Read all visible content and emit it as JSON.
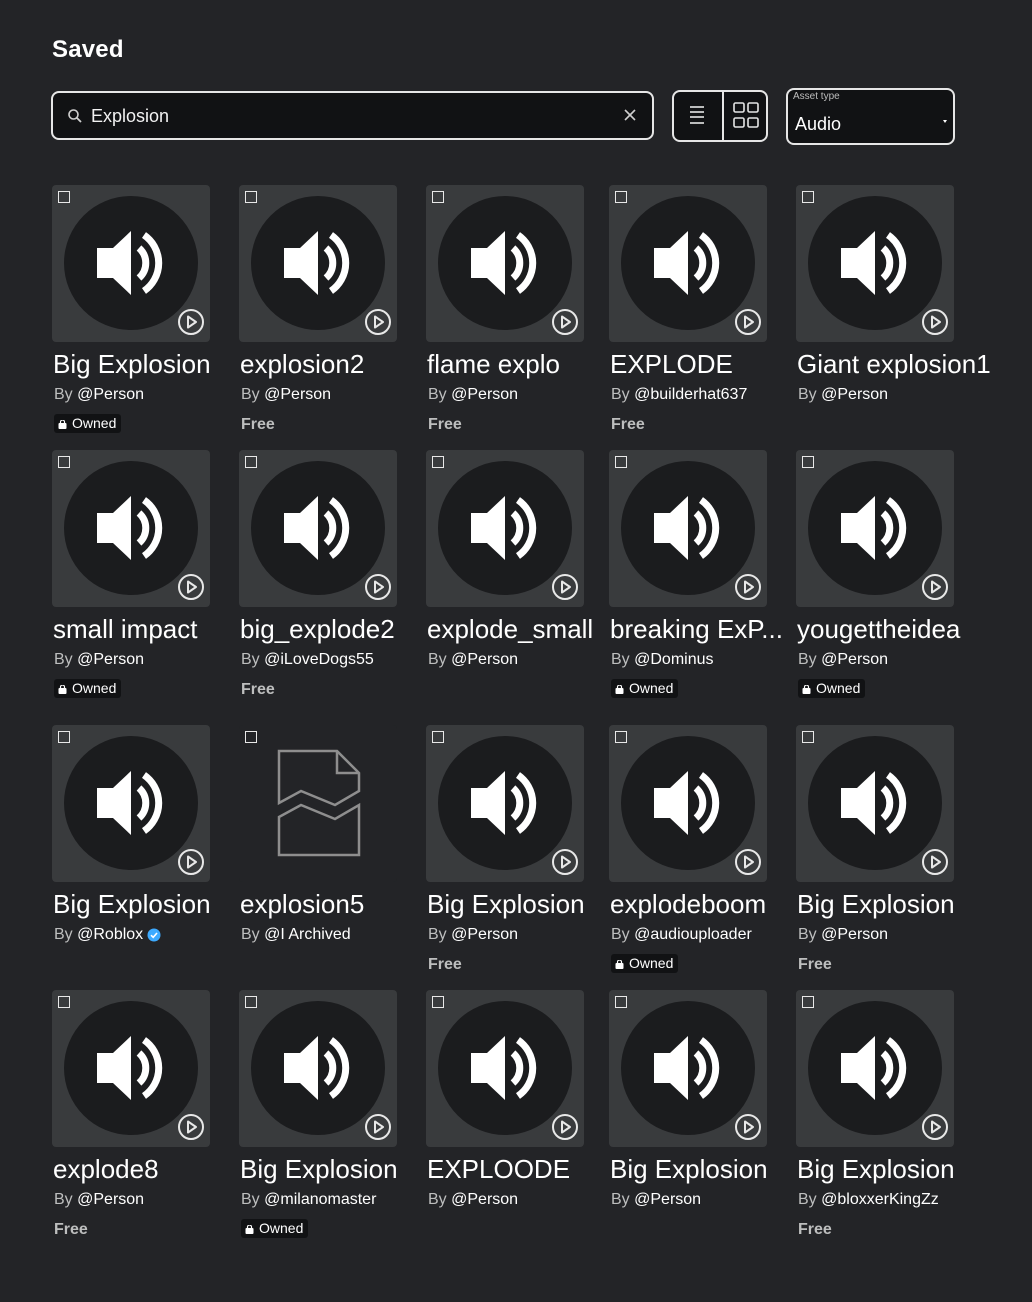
{
  "page": {
    "title": "Saved"
  },
  "search": {
    "value": "Explosion",
    "icon": "search-icon",
    "clear_icon": "close-icon"
  },
  "view_toggle": {
    "list_icon": "list-view-icon",
    "grid_icon": "grid-view-icon",
    "selected": "grid"
  },
  "asset_type": {
    "label": "Asset type",
    "value": "Audio"
  },
  "labels": {
    "by": "By",
    "at": "@",
    "owned": "Owned",
    "free": "Free"
  },
  "colors": {
    "background": "#232427",
    "thumbnail": "#393b3d",
    "verified": "#3daaff",
    "badge": "#111214"
  },
  "items": [
    {
      "name": "Big Explosion",
      "creator": "Person",
      "status": "Owned",
      "thumb": "audio"
    },
    {
      "name": "explosion2",
      "creator": "Person",
      "status": "Free",
      "thumb": "audio"
    },
    {
      "name": "flame explo",
      "creator": "Person",
      "status": "Free",
      "thumb": "audio"
    },
    {
      "name": "EXPLODE",
      "creator": "builderhat637",
      "status": "Free",
      "thumb": "audio"
    },
    {
      "name": "Giant explosion1",
      "creator": "Person",
      "status": "",
      "thumb": "audio"
    },
    {
      "name": "small impact",
      "creator": "Person",
      "status": "Owned",
      "thumb": "audio"
    },
    {
      "name": "big_explode2",
      "creator": "iLoveDogs55",
      "status": "Free",
      "thumb": "audio"
    },
    {
      "name": "explode_small",
      "creator": "Person",
      "status": "",
      "thumb": "audio"
    },
    {
      "name": "breaking ExP...",
      "creator": "Dominus",
      "status": "Owned",
      "thumb": "audio"
    },
    {
      "name": "yougettheidea",
      "creator": "Person",
      "status": "Owned",
      "thumb": "audio"
    },
    {
      "name": "Big Explosion",
      "creator": "Roblox",
      "verified": true,
      "status": "",
      "thumb": "audio"
    },
    {
      "name": "explosion5",
      "creator": "I Archived",
      "status": "",
      "thumb": "broken"
    },
    {
      "name": "Big Explosion",
      "creator": "Person",
      "status": "Free",
      "thumb": "audio"
    },
    {
      "name": "explodeboom",
      "creator": "audiouploader",
      "status": "Owned",
      "thumb": "audio"
    },
    {
      "name": "Big Explosion",
      "creator": "Person",
      "status": "Free",
      "thumb": "audio"
    },
    {
      "name": "explode8",
      "creator": "Person",
      "status": "Free",
      "thumb": "audio"
    },
    {
      "name": "Big Explosion",
      "creator": "milanomaster",
      "status": "Owned",
      "thumb": "audio"
    },
    {
      "name": "EXPLOODE",
      "creator": "Person",
      "status": "",
      "thumb": "audio"
    },
    {
      "name": "Big Explosion",
      "creator": "Person",
      "status": "",
      "thumb": "audio"
    },
    {
      "name": "Big Explosion",
      "creator": "bloxxerKingZz",
      "status": "Free",
      "thumb": "audio"
    }
  ]
}
